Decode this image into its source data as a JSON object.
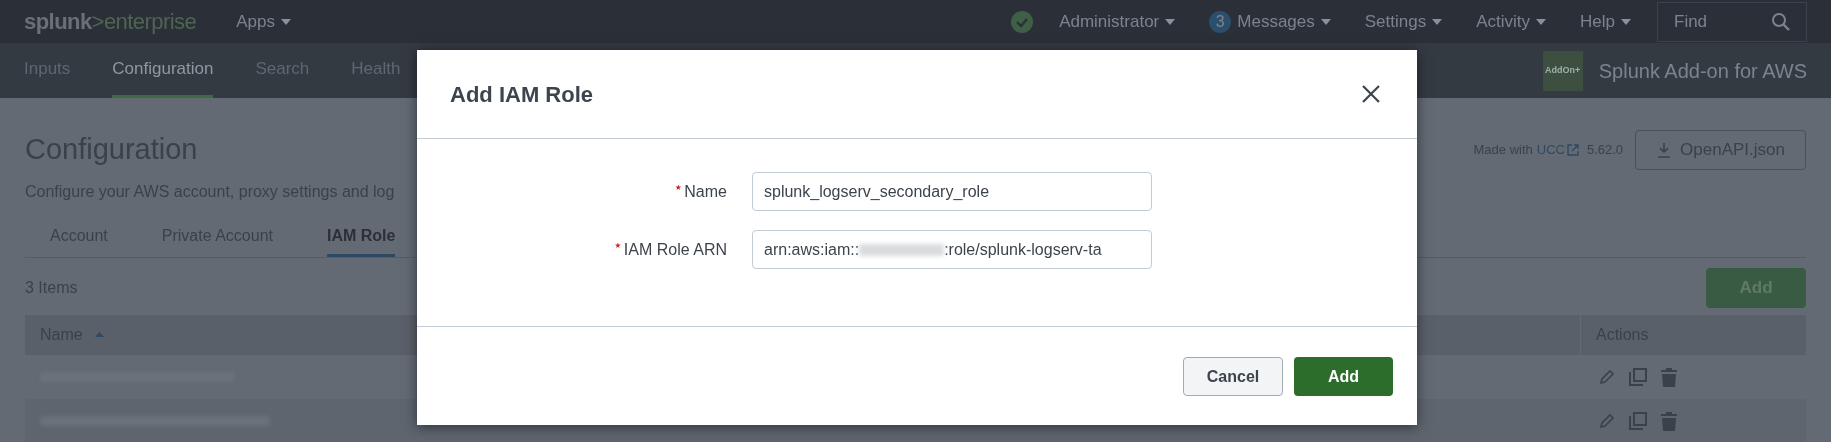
{
  "top_bar": {
    "logo": {
      "brand": "splunk",
      "separator": ">",
      "product": "enterprise"
    },
    "apps_menu": "Apps",
    "status_ok": true,
    "menus": [
      {
        "kind": "menu",
        "label": "Administrator"
      },
      {
        "kind": "badge-menu",
        "label": "Messages",
        "count": "3"
      },
      {
        "kind": "menu",
        "label": "Settings"
      },
      {
        "kind": "menu",
        "label": "Activity"
      },
      {
        "kind": "menu",
        "label": "Help"
      }
    ],
    "search": {
      "placeholder": "Find"
    }
  },
  "app_bar": {
    "nav": [
      {
        "label": "Inputs",
        "selected": false
      },
      {
        "label": "Configuration",
        "selected": true
      },
      {
        "label": "Search",
        "selected": false
      },
      {
        "label": "Health",
        "selected": false
      }
    ],
    "app_badge": "AddOn+",
    "app_title": "Splunk Add-on for AWS"
  },
  "page": {
    "title": "Configuration",
    "description": "Configure your AWS account, proxy settings and log",
    "made_with": {
      "prefix": "Made with",
      "link": "UCC",
      "version": "5.62.0"
    },
    "openapi_button": "OpenAPI.json",
    "tabs": [
      {
        "label": "Account",
        "selected": false
      },
      {
        "label": "Private Account",
        "selected": false
      },
      {
        "label": "IAM Role",
        "selected": true
      }
    ],
    "item_count": "3 Items",
    "add_button": "Add",
    "table": {
      "columns": [
        {
          "label": "Name",
          "sorted": true
        },
        {
          "label": "Actions",
          "sorted": false
        }
      ],
      "rows": [
        {
          "redacted": true
        },
        {
          "redacted": true
        }
      ]
    }
  },
  "dialog": {
    "title": "Add IAM Role",
    "fields": [
      {
        "label": "Name",
        "required": true,
        "value_parts": [
          "splunk_logserv_secondary_role"
        ]
      },
      {
        "label": "IAM Role ARN",
        "required": true,
        "value_parts": [
          "arn:aws:iam::",
          ":role/splunk-logserv-ta"
        ]
      }
    ],
    "buttons": [
      {
        "kind": "secondary",
        "label": "Cancel"
      },
      {
        "kind": "primary",
        "label": "Add"
      }
    ]
  }
}
